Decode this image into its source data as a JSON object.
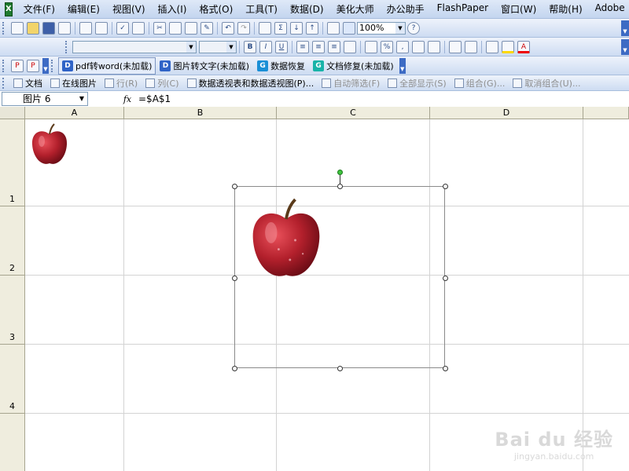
{
  "menubar": {
    "items": [
      "文件(F)",
      "编辑(E)",
      "视图(V)",
      "插入(I)",
      "格式(O)",
      "工具(T)",
      "数据(D)",
      "美化大师",
      "办公助手",
      "FlashPaper",
      "窗口(W)",
      "帮助(H)",
      "Adobe"
    ]
  },
  "toolbar1": {
    "zoom": "100%"
  },
  "toolbar3": {
    "addins": [
      {
        "label": "pdf转word(未加载)",
        "icon_letter": "D",
        "color": "#2f63c7"
      },
      {
        "label": "图片转文字(未加载)",
        "icon_letter": "D",
        "color": "#2f63c7"
      },
      {
        "label": "数据恢复",
        "icon_letter": "G",
        "color": "#1a8fd6"
      },
      {
        "label": "文档修复(未加载)",
        "icon_letter": "G",
        "color": "#19b3a8"
      }
    ]
  },
  "toolbar4": {
    "items": [
      {
        "label": "文档",
        "disabled": false
      },
      {
        "label": "在线图片",
        "disabled": false
      },
      {
        "label": "行(R)",
        "disabled": true
      },
      {
        "label": "列(C)",
        "disabled": true
      },
      {
        "label": "数据透视表和数据透视图(P)...",
        "disabled": false
      },
      {
        "label": "自动筛选(F)",
        "disabled": true
      },
      {
        "label": "全部显示(S)",
        "disabled": true
      },
      {
        "label": "组合(G)...",
        "disabled": true
      },
      {
        "label": "取消组合(U)...",
        "disabled": true
      }
    ]
  },
  "formula_bar": {
    "name_box": "图片 6",
    "fx_label": "fx",
    "formula": "=$A$1"
  },
  "sheet": {
    "columns": [
      "A",
      "B",
      "C",
      "D"
    ],
    "rows": [
      "1",
      "2",
      "3",
      "4"
    ]
  },
  "watermark": {
    "logo": "Bai du 经验",
    "url": "jingyan.baidu.com"
  },
  "icons": {
    "apple": "apple-icon",
    "app": "excel-icon"
  },
  "colors": {
    "apple_red": "#b3202c",
    "selection_handle": "#3ec43e"
  }
}
